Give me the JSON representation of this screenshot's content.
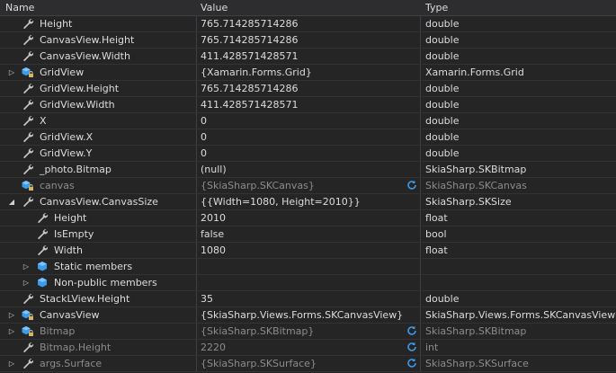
{
  "header": {
    "name": "Name",
    "value": "Value",
    "type": "Type"
  },
  "rows": [
    {
      "name": "Height",
      "value": "765.714285714286",
      "type": "double",
      "icon": "wrench-icon",
      "indent": 1,
      "expand": "",
      "dim": false,
      "refresh": false
    },
    {
      "name": "CanvasView.Height",
      "value": "765.714285714286",
      "type": "double",
      "icon": "wrench-icon",
      "indent": 1,
      "expand": "",
      "dim": false,
      "refresh": false
    },
    {
      "name": "CanvasView.Width",
      "value": "411.428571428571",
      "type": "double",
      "icon": "wrench-icon",
      "indent": 1,
      "expand": "",
      "dim": false,
      "refresh": false
    },
    {
      "name": "GridView",
      "value": "{Xamarin.Forms.Grid}",
      "type": "Xamarin.Forms.Grid",
      "icon": "object-lock-icon",
      "indent": 1,
      "expand": "collapsed",
      "dim": false,
      "refresh": false
    },
    {
      "name": "GridView.Height",
      "value": "765.714285714286",
      "type": "double",
      "icon": "wrench-icon",
      "indent": 1,
      "expand": "",
      "dim": false,
      "refresh": false
    },
    {
      "name": "GridView.Width",
      "value": "411.428571428571",
      "type": "double",
      "icon": "wrench-icon",
      "indent": 1,
      "expand": "",
      "dim": false,
      "refresh": false
    },
    {
      "name": "X",
      "value": "0",
      "type": "double",
      "icon": "wrench-icon",
      "indent": 1,
      "expand": "",
      "dim": false,
      "refresh": false
    },
    {
      "name": "GridView.X",
      "value": "0",
      "type": "double",
      "icon": "wrench-icon",
      "indent": 1,
      "expand": "",
      "dim": false,
      "refresh": false
    },
    {
      "name": "GridView.Y",
      "value": "0",
      "type": "double",
      "icon": "wrench-icon",
      "indent": 1,
      "expand": "",
      "dim": false,
      "refresh": false
    },
    {
      "name": "_photo.Bitmap",
      "value": "(null)",
      "type": "SkiaSharp.SKBitmap",
      "icon": "wrench-icon",
      "indent": 1,
      "expand": "",
      "dim": false,
      "refresh": false
    },
    {
      "name": "canvas",
      "value": "{SkiaSharp.SKCanvas}",
      "type": "SkiaSharp.SKCanvas",
      "icon": "object-lock-icon",
      "indent": 1,
      "expand": "",
      "dim": true,
      "refresh": true
    },
    {
      "name": "CanvasView.CanvasSize",
      "value": "{{Width=1080, Height=2010}}",
      "type": "SkiaSharp.SKSize",
      "icon": "wrench-icon",
      "indent": 1,
      "expand": "expanded",
      "dim": false,
      "refresh": false
    },
    {
      "name": "Height",
      "value": "2010",
      "type": "float",
      "icon": "wrench-icon",
      "indent": 2,
      "expand": "",
      "dim": false,
      "refresh": false
    },
    {
      "name": "IsEmpty",
      "value": "false",
      "type": "bool",
      "icon": "wrench-icon",
      "indent": 2,
      "expand": "",
      "dim": false,
      "refresh": false
    },
    {
      "name": "Width",
      "value": "1080",
      "type": "float",
      "icon": "wrench-icon",
      "indent": 2,
      "expand": "",
      "dim": false,
      "refresh": false
    },
    {
      "name": "Static members",
      "value": "",
      "type": "",
      "icon": "cube-icon",
      "indent": 2,
      "expand": "collapsed",
      "dim": false,
      "refresh": false
    },
    {
      "name": "Non-public members",
      "value": "",
      "type": "",
      "icon": "cube-icon",
      "indent": 2,
      "expand": "collapsed",
      "dim": false,
      "refresh": false
    },
    {
      "name": "StackLView.Height",
      "value": "35",
      "type": "double",
      "icon": "wrench-icon",
      "indent": 1,
      "expand": "",
      "dim": false,
      "refresh": false
    },
    {
      "name": "CanvasView",
      "value": "{SkiaSharp.Views.Forms.SKCanvasView}",
      "type": "SkiaSharp.Views.Forms.SKCanvasView",
      "icon": "object-lock-icon",
      "indent": 1,
      "expand": "collapsed",
      "dim": false,
      "refresh": false
    },
    {
      "name": "Bitmap",
      "value": "{SkiaSharp.SKBitmap}",
      "type": "SkiaSharp.SKBitmap",
      "icon": "object-lock-icon",
      "indent": 1,
      "expand": "collapsed",
      "dim": true,
      "refresh": true
    },
    {
      "name": "Bitmap.Height",
      "value": "2220",
      "type": "int",
      "icon": "wrench-icon",
      "indent": 1,
      "expand": "",
      "dim": true,
      "refresh": true
    },
    {
      "name": "args.Surface",
      "value": "{SkiaSharp.SKSurface}",
      "type": "SkiaSharp.SKSurface",
      "icon": "wrench-icon",
      "indent": 1,
      "expand": "collapsed",
      "dim": true,
      "refresh": true
    }
  ],
  "colors": {
    "refresh": "#3c9be8",
    "cube": "#3c9be8",
    "wrench": "#c8c8c8"
  }
}
